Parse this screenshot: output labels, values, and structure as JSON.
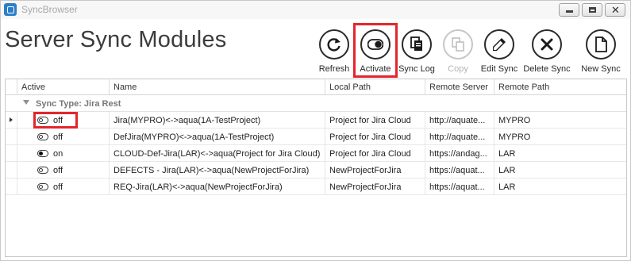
{
  "window": {
    "title": "SyncBrowser"
  },
  "page": {
    "title": "Server Sync Modules"
  },
  "toolbar": {
    "refresh": "Refresh",
    "activate": "Activate",
    "sync_log": "Sync Log",
    "copy": "Copy",
    "edit_sync": "Edit Sync",
    "delete_sync": "Delete Sync",
    "new_sync": "New Sync"
  },
  "grid": {
    "columns": [
      "Active",
      "Name",
      "Local Path",
      "Remote Server",
      "Remote Path"
    ],
    "group": "Sync Type: Jira Rest",
    "rows": [
      {
        "active": "off",
        "name": "Jira(MYPRO)<->aqua(1A-TestProject)",
        "local_path": "Project for Jira Cloud",
        "remote_server": "http://aquate...",
        "remote_path": "MYPRO"
      },
      {
        "active": "off",
        "name": "DefJira(MYPRO)<->aqua(1A-TestProject)",
        "local_path": "Project for Jira Cloud",
        "remote_server": "http://aquate...",
        "remote_path": "MYPRO"
      },
      {
        "active": "on",
        "name": "CLOUD-Def-Jira(LAR)<->aqua(Project for Jira Cloud)",
        "local_path": "Project for Jira Cloud",
        "remote_server": "https://andag...",
        "remote_path": "LAR"
      },
      {
        "active": "off",
        "name": "DEFECTS - Jira(LAR)<->aqua(NewProjectForJira)",
        "local_path": "NewProjectForJira",
        "remote_server": "https://aquat...",
        "remote_path": "LAR"
      },
      {
        "active": "off",
        "name": "REQ-Jira(LAR)<->aqua(NewProjectForJira)",
        "local_path": "NewProjectForJira",
        "remote_server": "https://aquat...",
        "remote_path": "LAR"
      }
    ]
  },
  "colors": {
    "highlight": "#e2262d",
    "app_icon": "#2b7fc8"
  }
}
